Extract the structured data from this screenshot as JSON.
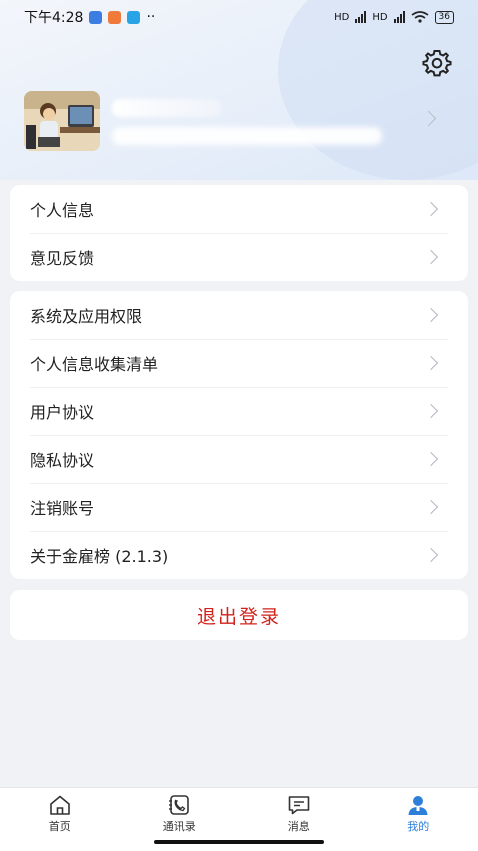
{
  "status": {
    "time": "下午4:28",
    "dots": "··",
    "signal1": "HD",
    "signal2": "HD",
    "battery": "36"
  },
  "header": {
    "settings_icon": "gear-icon"
  },
  "menu_group1": [
    {
      "label": "个人信息"
    },
    {
      "label": "意见反馈"
    }
  ],
  "menu_group2": [
    {
      "label": "系统及应用权限"
    },
    {
      "label": "个人信息收集清单"
    },
    {
      "label": "用户协议"
    },
    {
      "label": "隐私协议"
    },
    {
      "label": "注销账号"
    },
    {
      "label": "关于金雇榜 (2.1.3)"
    }
  ],
  "logout": {
    "label": "退出登录",
    "color": "#d0231c"
  },
  "tabs": [
    {
      "label": "首页",
      "icon": "home-icon"
    },
    {
      "label": "通讯录",
      "icon": "contacts-icon"
    },
    {
      "label": "消息",
      "icon": "message-icon"
    },
    {
      "label": "我的",
      "icon": "user-icon",
      "active": true
    }
  ],
  "colors": {
    "accent": "#2d7fd9",
    "danger": "#d0231c"
  }
}
